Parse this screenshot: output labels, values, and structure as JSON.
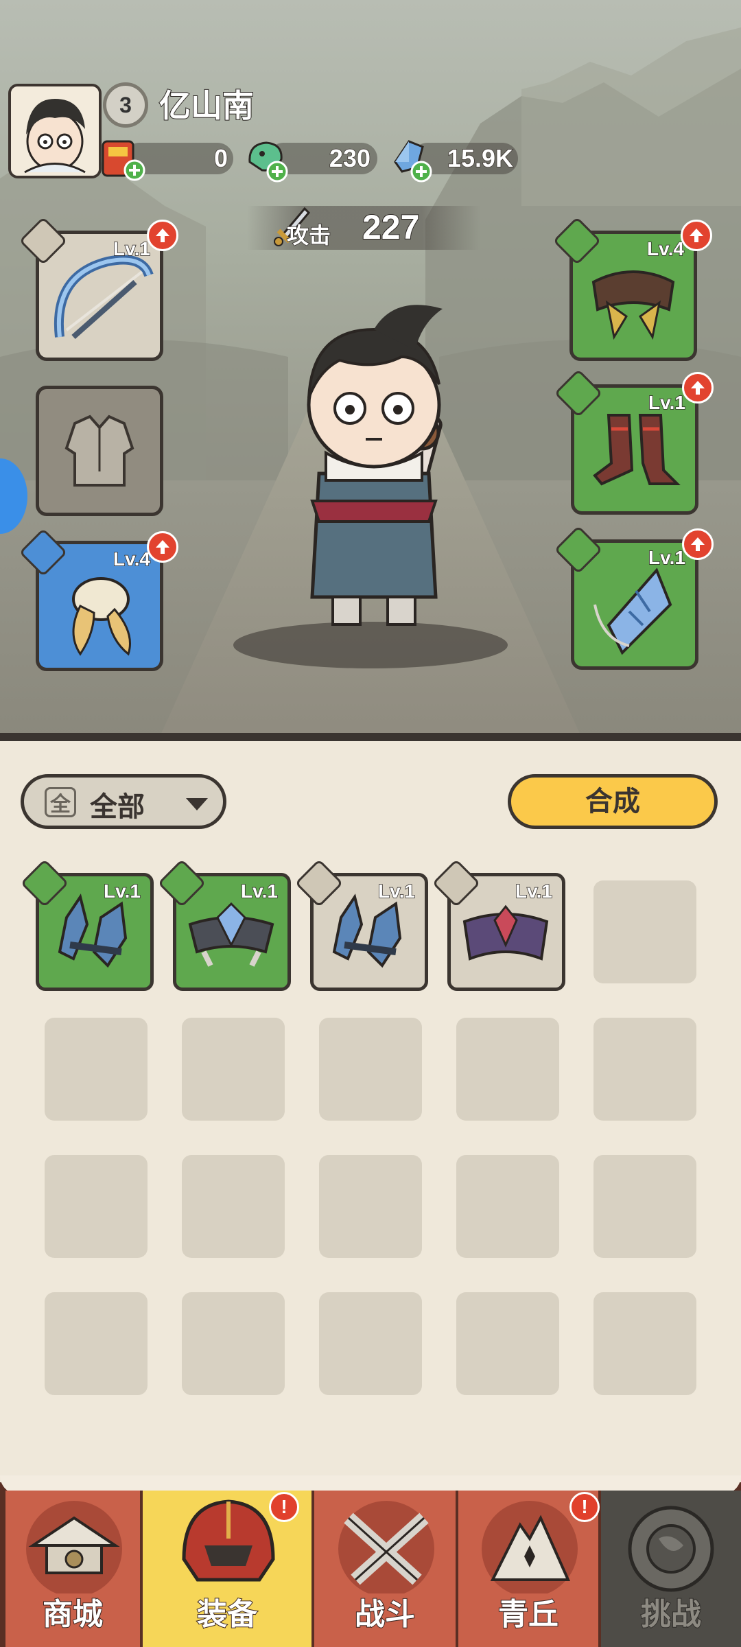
{
  "player": {
    "name": "亿山南",
    "level": "3"
  },
  "currencies": [
    {
      "icon": "red-envelope-icon",
      "value": "0"
    },
    {
      "icon": "jade-dragon-icon",
      "value": "230"
    },
    {
      "icon": "blue-crystal-icon",
      "value": "15.9K"
    }
  ],
  "attack": {
    "label": "攻击",
    "value": "227"
  },
  "equipment": {
    "weapon": {
      "icon": "crossbow-icon",
      "level": "Lv.1",
      "rarity": "gray"
    },
    "armor": {
      "icon": "vest-outline-icon",
      "level": "",
      "rarity": "empty"
    },
    "accessory": {
      "icon": "feather-ornament-icon",
      "level": "Lv.4",
      "rarity": "blue"
    },
    "belt": {
      "icon": "belt-icon",
      "level": "Lv.4",
      "rarity": "green"
    },
    "boots": {
      "icon": "boots-icon",
      "level": "Lv.1",
      "rarity": "green"
    },
    "pendant": {
      "icon": "jade-pendant-icon",
      "level": "Lv.1",
      "rarity": "green"
    }
  },
  "inventory": {
    "filter_label": "全部",
    "filter_icon_text": "全",
    "synthesize_label": "合成",
    "items": [
      {
        "icon": "blue-bracer-icon",
        "level": "Lv.1",
        "rarity": "green"
      },
      {
        "icon": "blue-belt-icon",
        "level": "Lv.1",
        "rarity": "green"
      },
      {
        "icon": "blue-bracer-icon",
        "level": "Lv.1",
        "rarity": "gray"
      },
      {
        "icon": "purple-belt-icon",
        "level": "Lv.1",
        "rarity": "gray"
      }
    ]
  },
  "nav": {
    "tabs": [
      {
        "label": "商城",
        "icon": "shop-pagoda-icon",
        "badge": ""
      },
      {
        "label": "装备",
        "icon": "helmet-icon",
        "badge": "!"
      },
      {
        "label": "战斗",
        "icon": "crossed-swords-icon",
        "badge": ""
      },
      {
        "label": "青丘",
        "icon": "fox-mountain-icon",
        "badge": "!"
      },
      {
        "label": "挑战",
        "icon": "locked-orb-icon",
        "badge": ""
      }
    ]
  },
  "colors": {
    "slot_green": "#5fa84e",
    "slot_blue": "#4d8fd6",
    "slot_gray": "#d9d2c3",
    "synthesize_button": "#fbc94a",
    "nav_active": "#f6d658",
    "nav_red": "#c9614a",
    "badge_red": "#e1402c"
  }
}
